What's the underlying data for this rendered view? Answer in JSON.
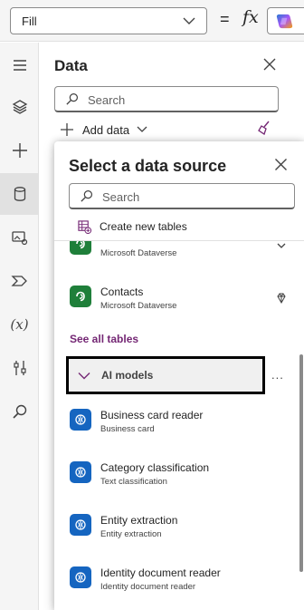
{
  "formula_bar": {
    "property_value": "Fill",
    "equals": "=",
    "fx_label": "fx"
  },
  "rail": {
    "items": [
      {
        "icon": "hamburger-icon"
      },
      {
        "icon": "layers-icon"
      },
      {
        "icon": "plus-icon"
      },
      {
        "icon": "database-icon",
        "active": true
      },
      {
        "icon": "media-icon"
      },
      {
        "icon": "power-automate-icon"
      },
      {
        "icon": "variables-icon",
        "text": "(x)"
      },
      {
        "icon": "tools-icon"
      },
      {
        "icon": "search-icon"
      }
    ]
  },
  "data_panel": {
    "title": "Data",
    "search_placeholder": "Search",
    "add_data_label": "Add data"
  },
  "flyout": {
    "title": "Select a data source",
    "search_placeholder": "Search",
    "create_new_tables": "Create new tables",
    "items": [
      {
        "name": "",
        "subtitle": "Microsoft Dataverse",
        "icon": "dataverse-icon",
        "trail": "chevron-down-icon"
      },
      {
        "name": "Contacts",
        "subtitle": "Microsoft Dataverse",
        "icon": "dataverse-icon",
        "trail": "premium-diamond-icon"
      }
    ],
    "see_all_tables": "See all tables",
    "ai_models_label": "AI models",
    "ai_models_more": "...",
    "ai_items": [
      {
        "name": "Business card reader",
        "subtitle": "Business card",
        "icon": "ai-model-icon"
      },
      {
        "name": "Category classification",
        "subtitle": "Text classification",
        "icon": "ai-model-icon"
      },
      {
        "name": "Entity extraction",
        "subtitle": "Entity extraction",
        "icon": "ai-model-icon"
      },
      {
        "name": "Identity document reader",
        "subtitle": "Identity document reader",
        "icon": "ai-model-icon"
      }
    ]
  },
  "colors": {
    "accent": "#742774",
    "dataverse_green": "#1f7f3a",
    "ai_blue": "#1565c0",
    "highlight_border": "#000000"
  }
}
